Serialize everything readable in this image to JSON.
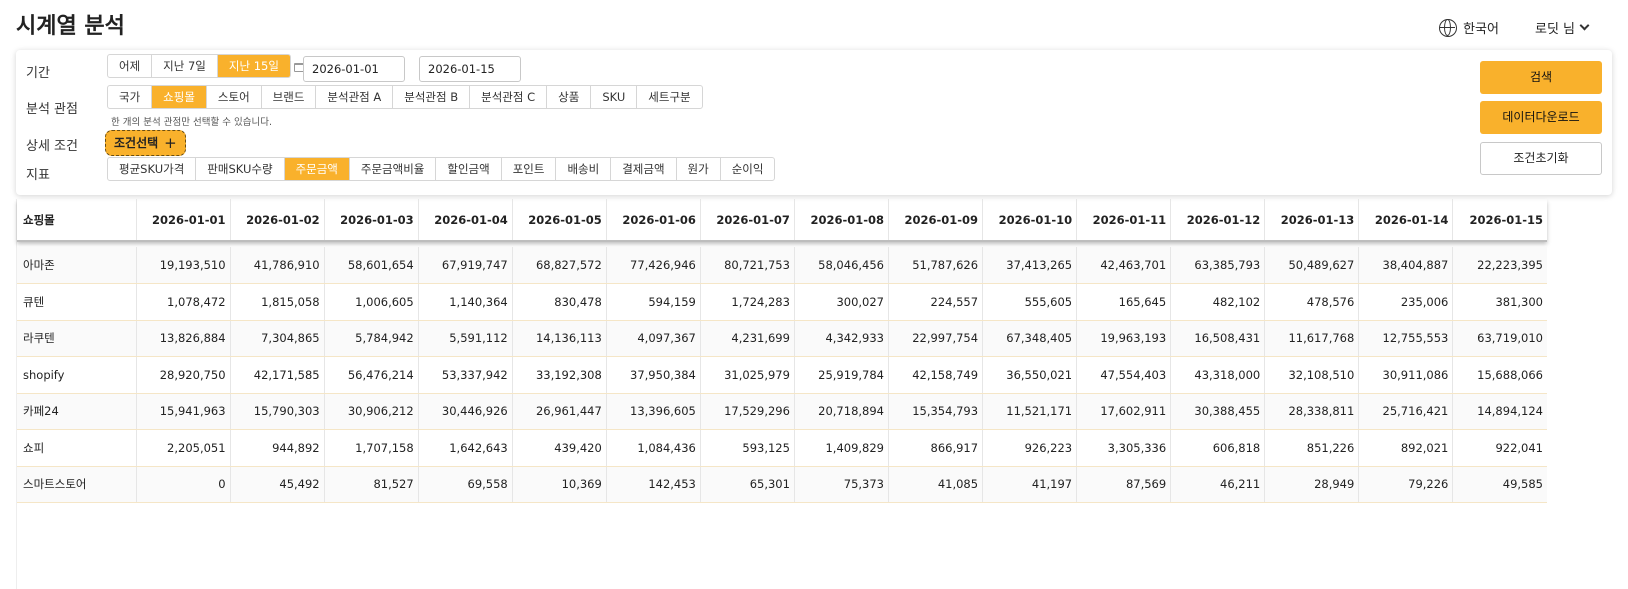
{
  "page_title": "시계열 분석",
  "topbar": {
    "language": "한국어",
    "user": "로딧 님"
  },
  "filters": {
    "period_label": "기간",
    "period_options": [
      "어제",
      "지난 7일",
      "지난 15일"
    ],
    "period_active": 2,
    "start_date": "2026-01-01",
    "end_date": "2026-01-15",
    "date_separator": "~",
    "perspective_label": "분석 관점",
    "perspective_options": [
      "국가",
      "쇼핑몰",
      "스토어",
      "브랜드",
      "분석관점 A",
      "분석관점 B",
      "분석관점 C",
      "상품",
      "SKU",
      "세트구분"
    ],
    "perspective_active": 1,
    "perspective_hint": "한 개의 분석 관점만 선택할 수 있습니다.",
    "detail_label": "상세 조건",
    "condition_button": "조건선택",
    "metric_label": "지표",
    "metric_options": [
      "평균SKU가격",
      "판매SKU수량",
      "주문금액",
      "주문금액비율",
      "할인금액",
      "포인트",
      "배송비",
      "결제금액",
      "원가",
      "순이익"
    ],
    "metric_active": 2
  },
  "actions": {
    "search": "검색",
    "download": "데이터다운로드",
    "reset": "조건초기화"
  },
  "table": {
    "first_header": "쇼핑몰",
    "dates": [
      "2026-01-01",
      "2026-01-02",
      "2026-01-03",
      "2026-01-04",
      "2026-01-05",
      "2026-01-06",
      "2026-01-07",
      "2026-01-08",
      "2026-01-09",
      "2026-01-10",
      "2026-01-11",
      "2026-01-12",
      "2026-01-13",
      "2026-01-14",
      "2026-01-15"
    ],
    "rows": [
      {
        "name": "아마존",
        "values": [
          "19,193,510",
          "41,786,910",
          "58,601,654",
          "67,919,747",
          "68,827,572",
          "77,426,946",
          "80,721,753",
          "58,046,456",
          "51,787,626",
          "37,413,265",
          "42,463,701",
          "63,385,793",
          "50,489,627",
          "38,404,887",
          "22,223,395"
        ]
      },
      {
        "name": "큐텐",
        "values": [
          "1,078,472",
          "1,815,058",
          "1,006,605",
          "1,140,364",
          "830,478",
          "594,159",
          "1,724,283",
          "300,027",
          "224,557",
          "555,605",
          "165,645",
          "482,102",
          "478,576",
          "235,006",
          "381,300"
        ]
      },
      {
        "name": "라쿠텐",
        "values": [
          "13,826,884",
          "7,304,865",
          "5,784,942",
          "5,591,112",
          "14,136,113",
          "4,097,367",
          "4,231,699",
          "4,342,933",
          "22,997,754",
          "67,348,405",
          "19,963,193",
          "16,508,431",
          "11,617,768",
          "12,755,553",
          "63,719,010"
        ]
      },
      {
        "name": "shopify",
        "values": [
          "28,920,750",
          "42,171,585",
          "56,476,214",
          "53,337,942",
          "33,192,308",
          "37,950,384",
          "31,025,979",
          "25,919,784",
          "42,158,749",
          "36,550,021",
          "47,554,403",
          "43,318,000",
          "32,108,510",
          "30,911,086",
          "15,688,066"
        ]
      },
      {
        "name": "카페24",
        "values": [
          "15,941,963",
          "15,790,303",
          "30,906,212",
          "30,446,926",
          "26,961,447",
          "13,396,605",
          "17,529,296",
          "20,718,894",
          "15,354,793",
          "11,521,171",
          "17,602,911",
          "30,388,455",
          "28,338,811",
          "25,716,421",
          "14,894,124"
        ]
      },
      {
        "name": "쇼피",
        "values": [
          "2,205,051",
          "944,892",
          "1,707,158",
          "1,642,643",
          "439,420",
          "1,084,436",
          "593,125",
          "1,409,829",
          "866,917",
          "926,223",
          "3,305,336",
          "606,818",
          "851,226",
          "892,021",
          "922,041"
        ]
      },
      {
        "name": "스마트스토어",
        "values": [
          "0",
          "45,492",
          "81,527",
          "69,558",
          "10,369",
          "142,453",
          "65,301",
          "75,373",
          "41,085",
          "41,197",
          "87,569",
          "46,211",
          "28,949",
          "79,226",
          "49,585"
        ]
      }
    ]
  }
}
